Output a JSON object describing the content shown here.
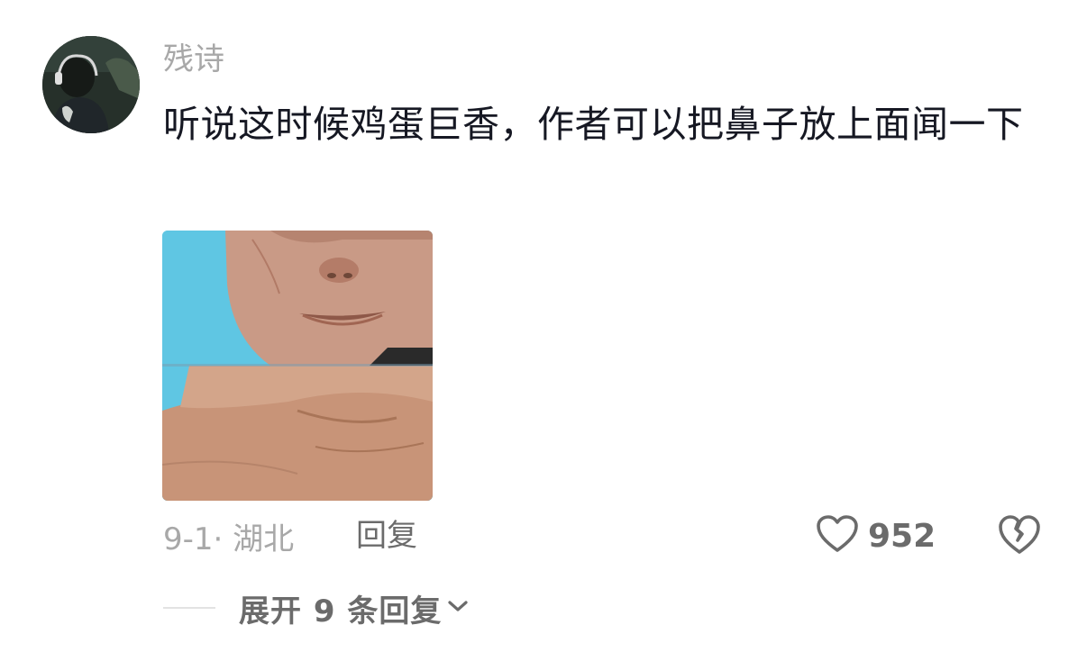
{
  "comment": {
    "username": "残诗",
    "text": "听说这时候鸡蛋巨香，作者可以把鼻子放上面闻一下",
    "date_location": "9-1· 湖北",
    "reply_label": "回复",
    "like_count": "952",
    "expand_label": "展开 9 条回复"
  },
  "colors": {
    "username": "#a8a8a8",
    "text": "#161823",
    "meta": "#a8a8a8",
    "action": "#6b6b6b",
    "image_bg": "#5fc6e3"
  },
  "icons": {
    "like": "heart-outline-icon",
    "dislike": "broken-heart-icon",
    "expand": "chevron-down-icon"
  }
}
